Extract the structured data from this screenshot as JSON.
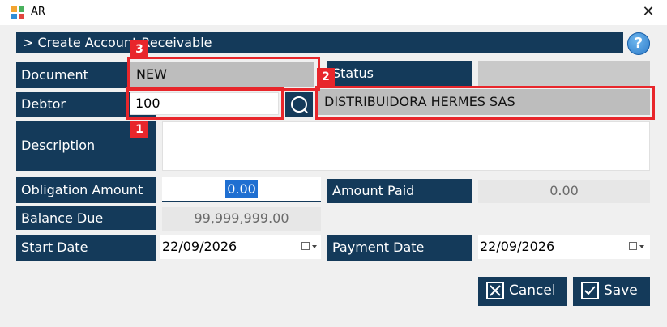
{
  "window": {
    "title": "AR",
    "close_glyph": "✕"
  },
  "header": {
    "title": "> Create Account Receivable",
    "help_glyph": "?"
  },
  "form": {
    "document": {
      "label": "Document",
      "value": "NEW"
    },
    "status": {
      "label": "Status",
      "value": ""
    },
    "debtor": {
      "label": "Debtor",
      "value": "100",
      "name": "DISTRIBUIDORA HERMES SAS"
    },
    "description": {
      "label": "Description",
      "value": ""
    },
    "obligation_amount": {
      "label": "Obligation Amount",
      "value": "0.00"
    },
    "amount_paid": {
      "label": "Amount Paid",
      "value": "0.00"
    },
    "balance_due": {
      "label": "Balance Due",
      "value": "99,999,999.00"
    },
    "start_date": {
      "label": "Start Date",
      "value": "22/09/2026"
    },
    "payment_date": {
      "label": "Payment Date",
      "value": "22/09/2026"
    }
  },
  "buttons": {
    "cancel": "Cancel",
    "save": "Save"
  },
  "annotations": {
    "badge1": "1",
    "badge2": "2",
    "badge3": "3"
  },
  "colors": {
    "label_bg": "#143a5a",
    "highlight": "#e8262b",
    "readonly_bg": "#bdbdbd"
  }
}
